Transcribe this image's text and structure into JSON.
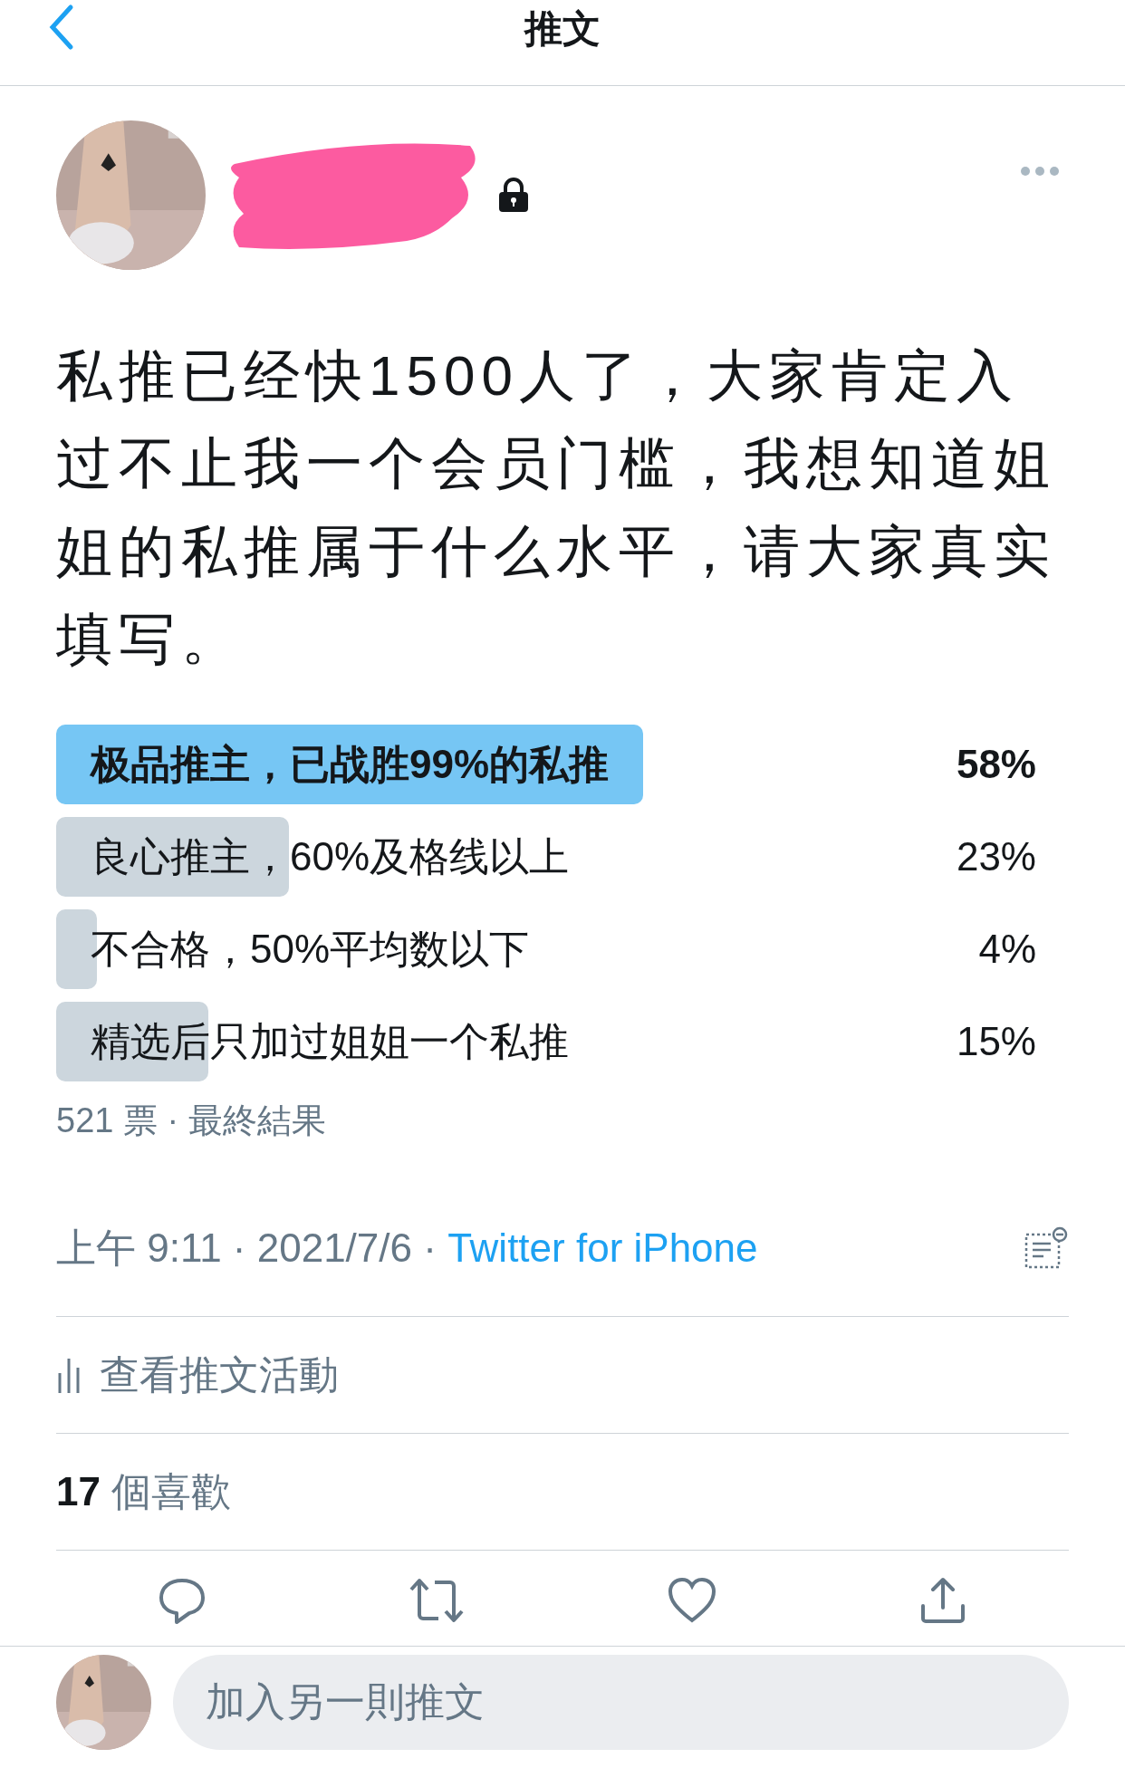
{
  "header": {
    "title": "推文"
  },
  "author": {
    "locked": true
  },
  "tweet": {
    "text": "私推已经快1500人了，大家肯定入过不止我一个会员门槛，我想知道姐姐的私推属于什么水平，请大家真实填写。"
  },
  "poll": {
    "options": [
      {
        "label": "极品推主，已战胜99%的私推",
        "percent": "58%",
        "winner": true
      },
      {
        "label": "良心推主，60%及格线以上",
        "percent": "23%",
        "winner": false
      },
      {
        "label": "不合格，50%平均数以下",
        "percent": "4%",
        "winner": false
      },
      {
        "label": "精选后只加过姐姐一个私推",
        "percent": "15%",
        "winner": false
      }
    ],
    "summary": "521 票 · 最終結果"
  },
  "meta": {
    "time": "上午 9:11",
    "separator": "·",
    "date": "2021/7/6",
    "source": "Twitter for iPhone"
  },
  "activity": "查看推文活動",
  "likes": {
    "count": "17",
    "label": "個喜歡"
  },
  "reply": {
    "placeholder": "加入另一則推文"
  }
}
